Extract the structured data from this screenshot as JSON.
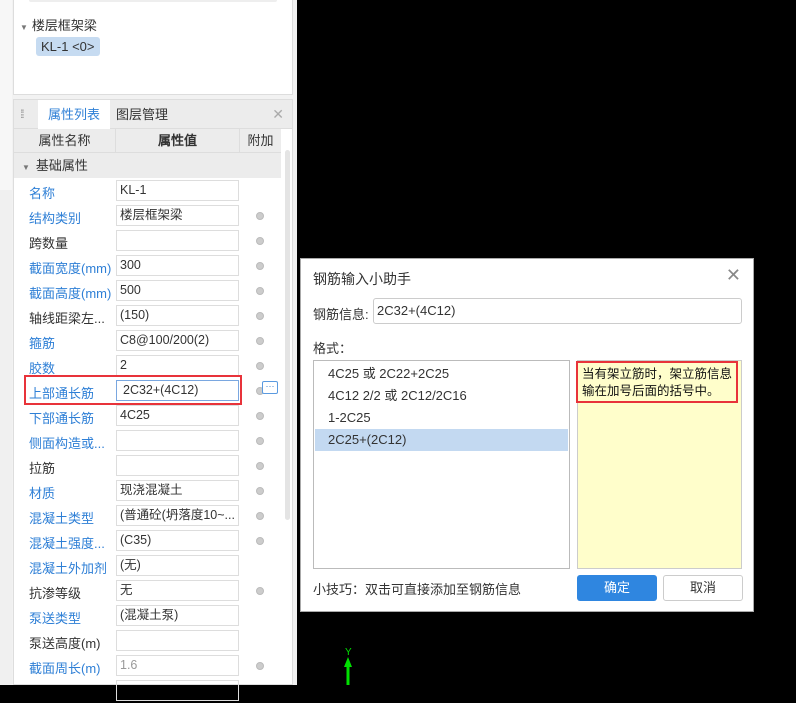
{
  "tree": {
    "group": "楼层框架梁",
    "item": "KL-1 <0>"
  },
  "panel": {
    "tabs": [
      "属性列表",
      "图层管理"
    ],
    "headers": [
      "属性名称",
      "属性值",
      "附加"
    ],
    "group": "基础属性"
  },
  "rows": [
    {
      "name": "名称",
      "value": "KL-1",
      "blue": true,
      "dot": false
    },
    {
      "name": "结构类别",
      "value": "楼层框架梁",
      "blue": true,
      "dot": true
    },
    {
      "name": "跨数量",
      "value": "",
      "blue": false,
      "dot": true
    },
    {
      "name": "截面宽度(mm)",
      "value": "300",
      "blue": true,
      "dot": true
    },
    {
      "name": "截面高度(mm)",
      "value": "500",
      "blue": true,
      "dot": true
    },
    {
      "name": "轴线距梁左...",
      "value": "(150)",
      "blue": false,
      "dot": true
    },
    {
      "name": "箍筋",
      "value": "C8@100/200(2)",
      "blue": true,
      "dot": true
    },
    {
      "name": "胶数",
      "value": "2",
      "blue": true,
      "dot": true
    },
    {
      "name": "上部通长筋",
      "value": "2C32+(4C12)",
      "blue": true,
      "dot": true,
      "highlight": true
    },
    {
      "name": "下部通长筋",
      "value": "4C25",
      "blue": true,
      "dot": true
    },
    {
      "name": "侧面构造或...",
      "value": "",
      "blue": true,
      "dot": true
    },
    {
      "name": "拉筋",
      "value": "",
      "blue": false,
      "dot": true
    },
    {
      "name": "材质",
      "value": "现浇混凝土",
      "blue": true,
      "dot": true
    },
    {
      "name": "混凝土类型",
      "value": "(普通砼(坍落度10~...",
      "blue": true,
      "dot": true
    },
    {
      "name": "混凝土强度...",
      "value": "(C35)",
      "blue": true,
      "dot": true
    },
    {
      "name": "混凝土外加剂",
      "value": "(无)",
      "blue": true,
      "dot": false
    },
    {
      "name": "抗渗等级",
      "value": "无",
      "blue": false,
      "dot": true
    },
    {
      "name": "泵送类型",
      "value": "(混凝土泵)",
      "blue": true,
      "dot": false
    },
    {
      "name": "泵送高度(m)",
      "value": "",
      "blue": false,
      "dot": false
    },
    {
      "name": "截面周长(m)",
      "value": "1.6",
      "blue": true,
      "dot": true,
      "gray": true
    },
    {
      "name": "",
      "value": "",
      "blue": false,
      "dot": false
    }
  ],
  "dialog": {
    "title": "钢筋输入小助手",
    "info_label": "钢筋信息:",
    "info_value": "2C32+(4C12)",
    "format_label": "格式：",
    "formats": [
      "4C25 或 2C22+2C25",
      "4C12 2/2 或 2C12/2C16",
      "1-2C25",
      "2C25+(2C12)"
    ],
    "selected_index": 3,
    "note": "当有架立筋时，架立筋信息输在加号后面的括号中。",
    "tip": "小技巧：双击可直接添加至钢筋信息",
    "ok": "确定",
    "cancel": "取消"
  },
  "axis": {
    "y_label": "Y"
  }
}
